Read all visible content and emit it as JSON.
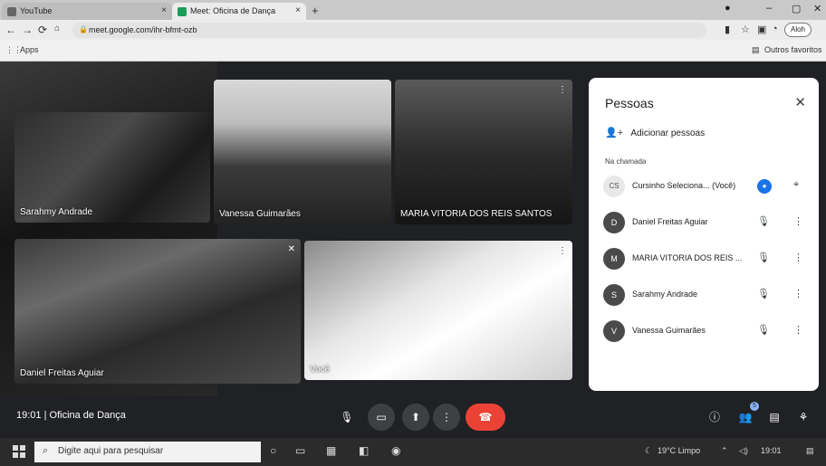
{
  "browser": {
    "tabs": [
      {
        "label": "YouTube"
      },
      {
        "label": "Meet: Oficina de Dança"
      }
    ],
    "address": "meet.google.com/ihr-bfmt-ozb",
    "bookmarks_apps": "Apps",
    "bookmarks_other": "Outros favoritos",
    "profile_pill": "Aloh"
  },
  "meet": {
    "tiles": [
      {
        "name": "Sarahmy Andrade"
      },
      {
        "name": "Vanessa Guimarães"
      },
      {
        "name": "MARIA VITORIA DOS REIS SANTOS"
      },
      {
        "name": "Daniel Freitas Aguiar"
      },
      {
        "name": "Você"
      }
    ],
    "panel": {
      "title": "Pessoas",
      "add_people": "Adicionar pessoas",
      "section_label": "Na chamada",
      "participants": [
        {
          "name": "Cursinho Seleciona...",
          "suffix": "(Você)"
        },
        {
          "name": "Daniel Freitas Aguiar"
        },
        {
          "name": "MARIA VITORIA DOS REIS ..."
        },
        {
          "name": "Sarahmy Andrade"
        },
        {
          "name": "Vanessa Guimarães"
        }
      ]
    },
    "bottom": {
      "time": "19:01",
      "meeting_name": "Oficina de Dança",
      "people_count": "5"
    }
  },
  "taskbar": {
    "search_placeholder": "Digite aqui para pesquisar",
    "weather": "19°C Limpo",
    "clock": "19:01"
  }
}
